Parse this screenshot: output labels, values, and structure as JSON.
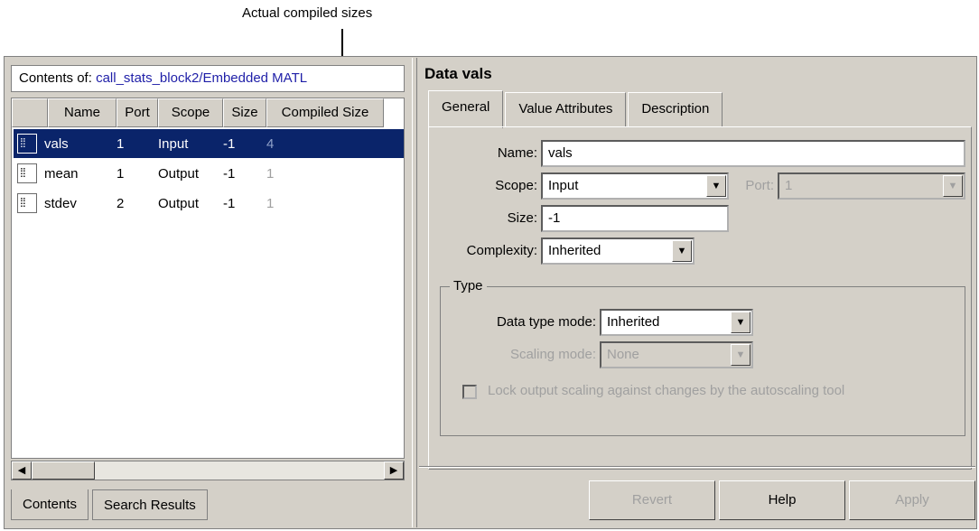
{
  "annotation": "Actual compiled sizes",
  "contents": {
    "label": "Contents of:",
    "path": "call_stats_block2/Embedded MATL"
  },
  "table": {
    "headers": [
      "Name",
      "Port",
      "Scope",
      "Size",
      "Compiled Size"
    ],
    "rows": [
      {
        "name": "vals",
        "port": "1",
        "scope": "Input",
        "size": "-1",
        "compiled": "4"
      },
      {
        "name": "mean",
        "port": "1",
        "scope": "Output",
        "size": "-1",
        "compiled": "1"
      },
      {
        "name": "stdev",
        "port": "2",
        "scope": "Output",
        "size": "-1",
        "compiled": "1"
      }
    ]
  },
  "bottom_tabs": [
    "Contents",
    "Search Results"
  ],
  "dialog": {
    "title": "Data vals",
    "tabs": [
      "General",
      "Value Attributes",
      "Description"
    ],
    "name_label": "Name:",
    "name_value": "vals",
    "scope_label": "Scope:",
    "scope_value": "Input",
    "port_label": "Port:",
    "port_value": "1",
    "size_label": "Size:",
    "size_value": "-1",
    "complexity_label": "Complexity:",
    "complexity_value": "Inherited",
    "type_group": "Type",
    "dtmode_label": "Data type mode:",
    "dtmode_value": "Inherited",
    "scaling_label": "Scaling mode:",
    "scaling_value": "None",
    "lock_label": "Lock output scaling against changes by the autoscaling tool"
  },
  "buttons": {
    "revert": "Revert",
    "help": "Help",
    "apply": "Apply"
  }
}
